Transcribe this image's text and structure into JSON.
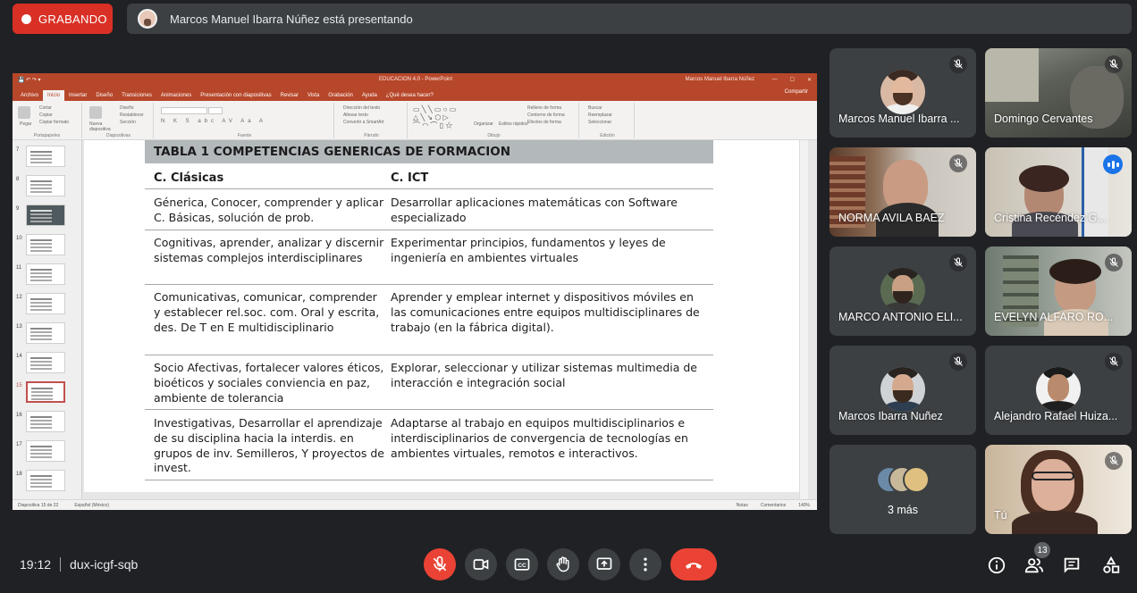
{
  "recording": {
    "label": "GRABANDO",
    "color": "#d93025"
  },
  "presenting_banner": {
    "text": "Marcos Manuel Ibarra Núñez está presentando"
  },
  "powerpoint": {
    "doc_title": "EDUCACION 4.0 - PowerPoint",
    "user": "Marcos Manuel Ibarra Núñez",
    "tabs": [
      "Archivo",
      "Inicio",
      "Insertar",
      "Diseño",
      "Transiciones",
      "Animaciones",
      "Presentación con diapositivas",
      "Revisar",
      "Vista",
      "Grabación",
      "Ayuda",
      "¿Qué desea hacer?"
    ],
    "active_tab": "Inicio",
    "share_label": "Compartir",
    "ribbon_groups": [
      "Portapapeles",
      "Diapositivas",
      "Fuente",
      "Párrafo",
      "Dibujo",
      "Edición"
    ],
    "ribbon_items": {
      "paste": "Pegar",
      "cut": "Cortar",
      "copy": "Copiar",
      "format_painter": "Copiar formato",
      "new_slide": "Nueva diapositiva",
      "layout": "Diseño",
      "reset": "Restablecer",
      "section": "Sección",
      "text_direction": "Dirección del texto",
      "align_text": "Alinear texto",
      "smartart": "Convertir a SmartArt",
      "arrange": "Organizar",
      "quick_styles": "Estilos rápidos",
      "shape_fill": "Relleno de forma",
      "shape_outline": "Contorno de forma",
      "shape_effects": "Efectos de forma",
      "find": "Buscar",
      "replace": "Reemplazar",
      "select": "Seleccionar"
    },
    "thumbnails": [
      "7",
      "8",
      "9",
      "10",
      "11",
      "12",
      "13",
      "14",
      "15",
      "16",
      "17",
      "18"
    ],
    "selected_thumbnail": "15",
    "status": {
      "slide_info": "Diapositiva 15 de 22",
      "language": "Español (México)",
      "notes": "Notas",
      "comments": "Comentarios",
      "zoom": "140%"
    }
  },
  "slide": {
    "title": "TABLA 1 COMPETENCIAS GENERICAS DE FORMACION",
    "header_left": "C. Clásicas",
    "header_right": "C. ICT",
    "rows": [
      {
        "left": "Génerica, Conocer, comprender y aplicar C. Básicas, solución de prob.",
        "right": "Desarrollar aplicaciones matemáticas con Software especializado"
      },
      {
        "left": "Cognitivas, aprender, analizar y discernir sistemas complejos interdisciplinares",
        "right": "Experimentar principios, fundamentos y leyes de ingeniería en ambientes virtuales"
      },
      {
        "left": "Comunicativas, comunicar, comprender y establecer rel.soc. com. Oral y escrita, des. De T en E multidisciplinario",
        "right": "Aprender y emplear internet y dispositivos móviles en las comunicaciones entre equipos multidisciplinares de trabajo (en la fábrica digital)."
      },
      {
        "left": "Socio Afectivas, fortalecer valores éticos, bioéticos y sociales conviencia en paz, ambiente de tolerancia",
        "right": "Explorar, seleccionar y utilizar sistemas multimedia de interacción e integración social"
      },
      {
        "left": "Investigativas, Desarrollar el aprendizaje de su disciplina hacia la interdis. en grupos de inv. Semilleros, Y  proyectos de invest.",
        "right": "Adaptarse al trabajo en equipos multidisciplinarios e interdisciplinarios de convergencia de tecnologías en ambientes virtuales, remotos e interactivos."
      }
    ]
  },
  "participants": [
    {
      "name": "Marcos Manuel Ibarra ...",
      "muted": true
    },
    {
      "name": "Domingo Cervantes",
      "muted": true
    },
    {
      "name": "NORMA AVILA BAEZ",
      "muted": true
    },
    {
      "name": "Cristina Recéndez G...",
      "muted": false,
      "speaking": true
    },
    {
      "name": "MARCO ANTONIO ELI...",
      "muted": true
    },
    {
      "name": "EVELYN ALFARO RO...",
      "muted": true
    },
    {
      "name": "Marcos Ibarra Nuñez",
      "muted": true
    },
    {
      "name": "Alejandro Rafael Huiza...",
      "muted": true
    },
    {
      "name": "3 más"
    },
    {
      "name": "Tú",
      "muted": true
    }
  ],
  "meeting": {
    "time": "19:12",
    "code": "dux-icgf-sqb"
  },
  "controls": {
    "mic_icon": "mic-off-icon",
    "camera_icon": "videocam-icon",
    "captions_icon": "closed-captions-icon",
    "hand_icon": "raise-hand-icon",
    "present_icon": "present-screen-icon",
    "more_icon": "more-vert-icon",
    "hangup_icon": "call-end-icon",
    "info_icon": "info-icon",
    "people_icon": "people-icon",
    "chat_icon": "chat-icon",
    "activities_icon": "activities-icon",
    "people_count": "13"
  },
  "colors": {
    "meet_bg": "#202124",
    "tile_bg": "#3c4043",
    "red": "#ea4335",
    "ppt_accent": "#b7472a",
    "speaking_blue": "#1a73e8"
  }
}
